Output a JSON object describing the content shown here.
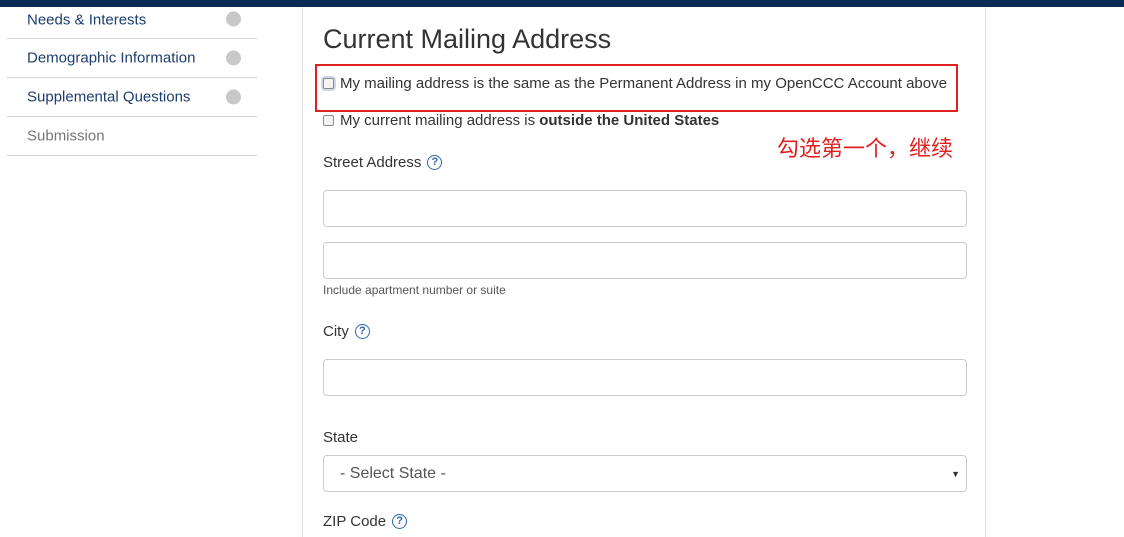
{
  "sidebar": {
    "items": [
      {
        "label": "Needs & Interests"
      },
      {
        "label": "Demographic Information"
      },
      {
        "label": "Supplemental Questions"
      },
      {
        "label": "Submission"
      }
    ]
  },
  "main": {
    "title": "Current Mailing Address",
    "checkbox_same_address": "My mailing address is the same as the Permanent Address in my OpenCCC Account above",
    "checkbox_outside_us_prefix": "My current mailing address is ",
    "checkbox_outside_us_bold": "outside the United States",
    "street_label": "Street Address",
    "street_line1_value": "",
    "street_line2_value": "",
    "street_hint": "Include apartment number or suite",
    "city_label": "City",
    "city_value": "",
    "state_label": "State",
    "state_selected": "- Select State -",
    "zip_label": "ZIP Code",
    "help_glyph": "?"
  },
  "annotation": {
    "text": "勾选第一个，继续"
  },
  "colors": {
    "top_bar": "#0b2a55",
    "nav_text": "#1c3d6e",
    "annotation_red": "#e02020",
    "help_blue": "#2a66b0"
  }
}
